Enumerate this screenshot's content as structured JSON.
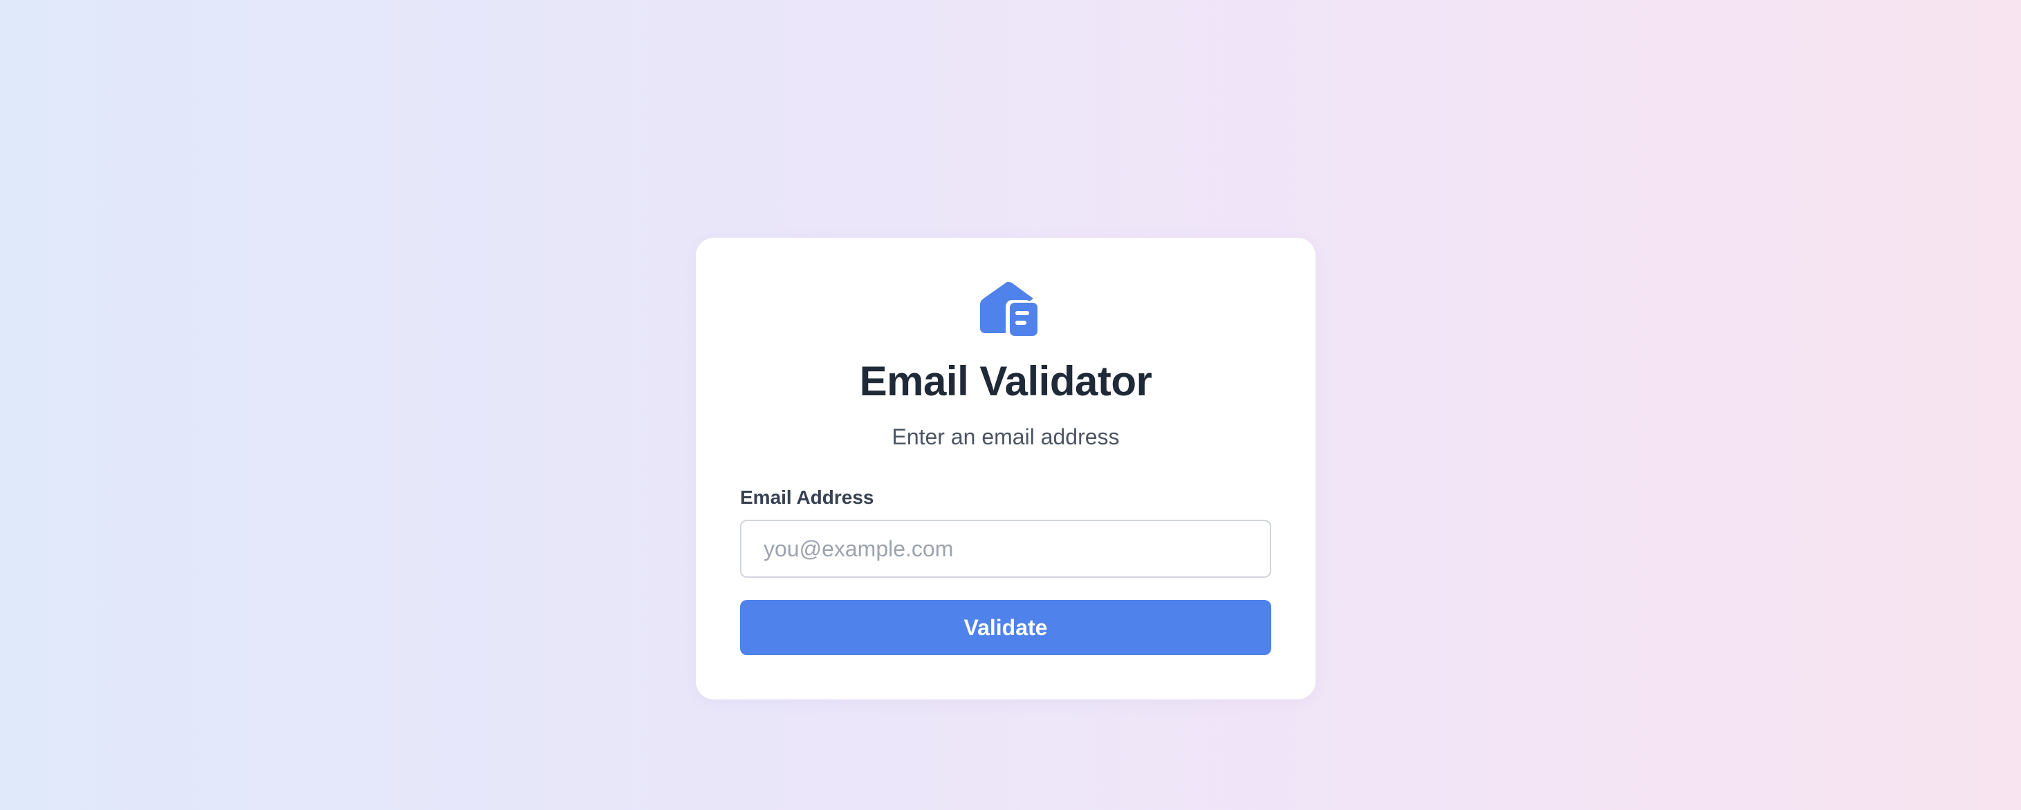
{
  "app": {
    "logo_icon": "email-validator-logo-icon",
    "title": "Email Validator",
    "subtitle": "Enter an email address"
  },
  "form": {
    "email_label": "Email Address",
    "email_value": "",
    "email_placeholder": "you@example.com",
    "submit_label": "Validate"
  },
  "colors": {
    "accent": "#4f82ea",
    "title_text": "#1f2937",
    "background_start": "#e0e9fa",
    "background_end": "#f7e4f0",
    "card": "#ffffff"
  }
}
